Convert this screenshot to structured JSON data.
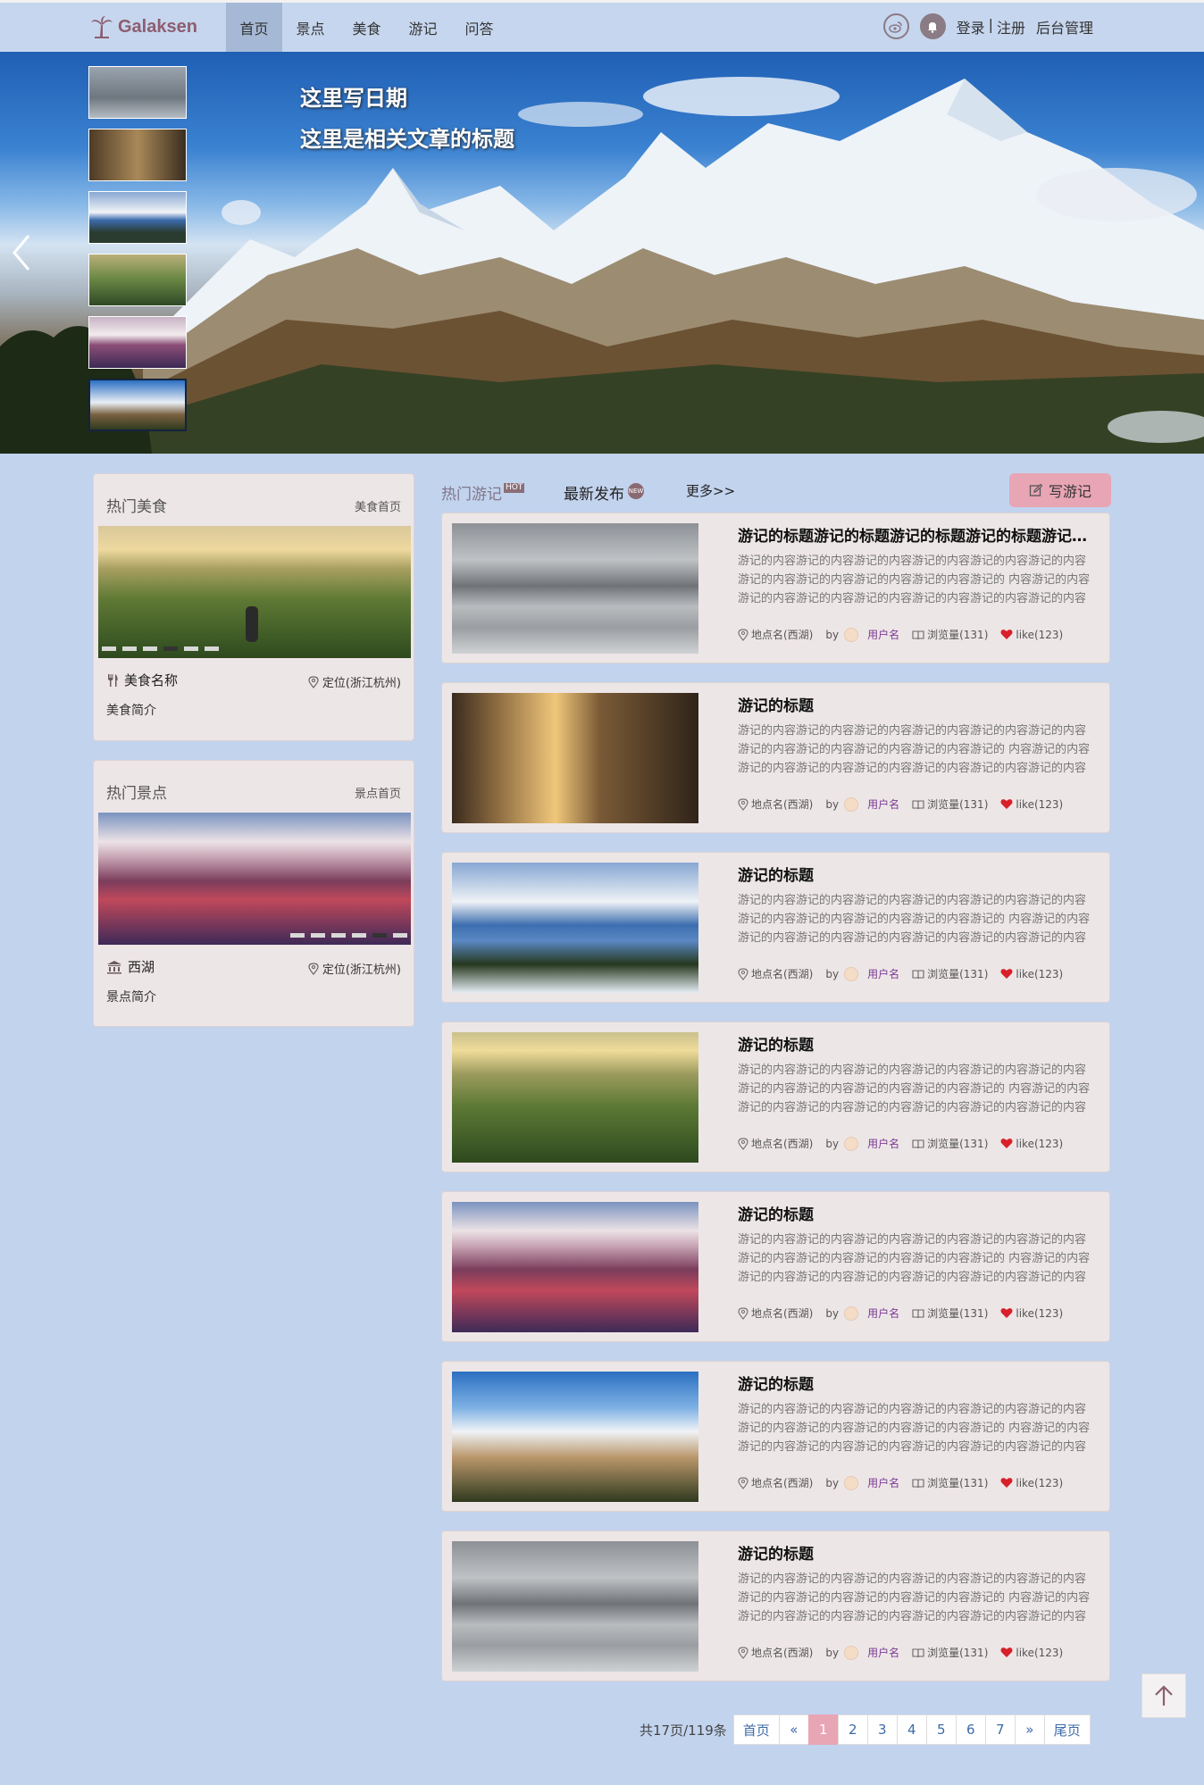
{
  "nav": {
    "brand": "Galaksen",
    "items": [
      "首页",
      "景点",
      "美食",
      "游记",
      "问答"
    ],
    "active_index": 0,
    "login": "登录",
    "separator": "|",
    "register": "注册",
    "admin": "后台管理"
  },
  "hero": {
    "date": "这里写日期",
    "title": "这里是相关文章的标题"
  },
  "hot_food": {
    "heading": "热门美食",
    "more": "美食首页",
    "name": "美食名称",
    "location": "定位(浙江杭州)",
    "intro": "美食简介"
  },
  "hot_spot": {
    "heading": "热门景点",
    "more": "景点首页",
    "name": "西湖",
    "location": "定位(浙江杭州)",
    "intro": "景点简介"
  },
  "tabs": {
    "hot": "热门游记",
    "hot_badge": "HOT",
    "latest": "最新发布",
    "new_badge": "NEW",
    "more": "更多>>",
    "write": "写游记"
  },
  "posts": [
    {
      "title": "游记的标题游记的标题游记的标题游记的标题游记的标题",
      "body": "游记的内容游记的内容游记的内容游记的内容游记的内容游记的内容游记的内容游记的内容游记的内容游记的内容游记的 内容游记的内容游记的内容游记的内容游记的内容游记的内容游记的内容游记的内容",
      "place": "地点名(西湖)",
      "by": "by",
      "user": "用户名",
      "views": "浏览量(131)",
      "likes": "like(123)"
    },
    {
      "title": "游记的标题",
      "body": "游记的内容游记的内容游记的内容游记的内容游记的内容游记的内容游记的内容游记的内容游记的内容游记的内容游记的 内容游记的内容游记的内容游记的内容游记的内容游记的内容游记的内容游记的内容",
      "place": "地点名(西湖)",
      "by": "by",
      "user": "用户名",
      "views": "浏览量(131)",
      "likes": "like(123)"
    },
    {
      "title": "游记的标题",
      "body": "游记的内容游记的内容游记的内容游记的内容游记的内容游记的内容游记的内容游记的内容游记的内容游记的内容游记的 内容游记的内容游记的内容游记的内容游记的内容游记的内容游记的内容游记的内容",
      "place": "地点名(西湖)",
      "by": "by",
      "user": "用户名",
      "views": "浏览量(131)",
      "likes": "like(123)"
    },
    {
      "title": "游记的标题",
      "body": "游记的内容游记的内容游记的内容游记的内容游记的内容游记的内容游记的内容游记的内容游记的内容游记的内容游记的 内容游记的内容游记的内容游记的内容游记的内容游记的内容游记的内容游记的内容",
      "place": "地点名(西湖)",
      "by": "by",
      "user": "用户名",
      "views": "浏览量(131)",
      "likes": "like(123)"
    },
    {
      "title": "游记的标题",
      "body": "游记的内容游记的内容游记的内容游记的内容游记的内容游记的内容游记的内容游记的内容游记的内容游记的内容游记的 内容游记的内容游记的内容游记的内容游记的内容游记的内容游记的内容游记的内容",
      "place": "地点名(西湖)",
      "by": "by",
      "user": "用户名",
      "views": "浏览量(131)",
      "likes": "like(123)"
    },
    {
      "title": "游记的标题",
      "body": "游记的内容游记的内容游记的内容游记的内容游记的内容游记的内容游记的内容游记的内容游记的内容游记的内容游记的 内容游记的内容游记的内容游记的内容游记的内容游记的内容游记的内容游记的内容",
      "place": "地点名(西湖)",
      "by": "by",
      "user": "用户名",
      "views": "浏览量(131)",
      "likes": "like(123)"
    },
    {
      "title": "游记的标题",
      "body": "游记的内容游记的内容游记的内容游记的内容游记的内容游记的内容游记的内容游记的内容游记的内容游记的内容游记的 内容游记的内容游记的内容游记的内容游记的内容游记的内容游记的内容游记的内容",
      "place": "地点名(西湖)",
      "by": "by",
      "user": "用户名",
      "views": "浏览量(131)",
      "likes": "like(123)"
    }
  ],
  "pager": {
    "info": "共17页/119条",
    "first": "首页",
    "prev": "«",
    "pages": [
      "1",
      "2",
      "3",
      "4",
      "5",
      "6",
      "7"
    ],
    "current": "1",
    "next": "»",
    "last": "尾页"
  },
  "colors": {
    "page_bg": "#c2d3ee",
    "accent_pink": "#e8a5b4",
    "brand": "#8d5e70",
    "card_bg": "#ede6e6",
    "user_link": "#7b3b96",
    "heart": "#d8202a"
  },
  "icons": {
    "brand": "palm-tree-icon",
    "weibo": "weibo-icon",
    "bell": "bell-icon",
    "prev_slide": "chevron-left-icon",
    "fork_knife": "utensils-icon",
    "museum": "landmark-icon",
    "pin": "map-pin-icon",
    "edit": "edit-icon",
    "book": "book-icon",
    "heart": "heart-icon",
    "to_top": "arrow-up-icon"
  }
}
